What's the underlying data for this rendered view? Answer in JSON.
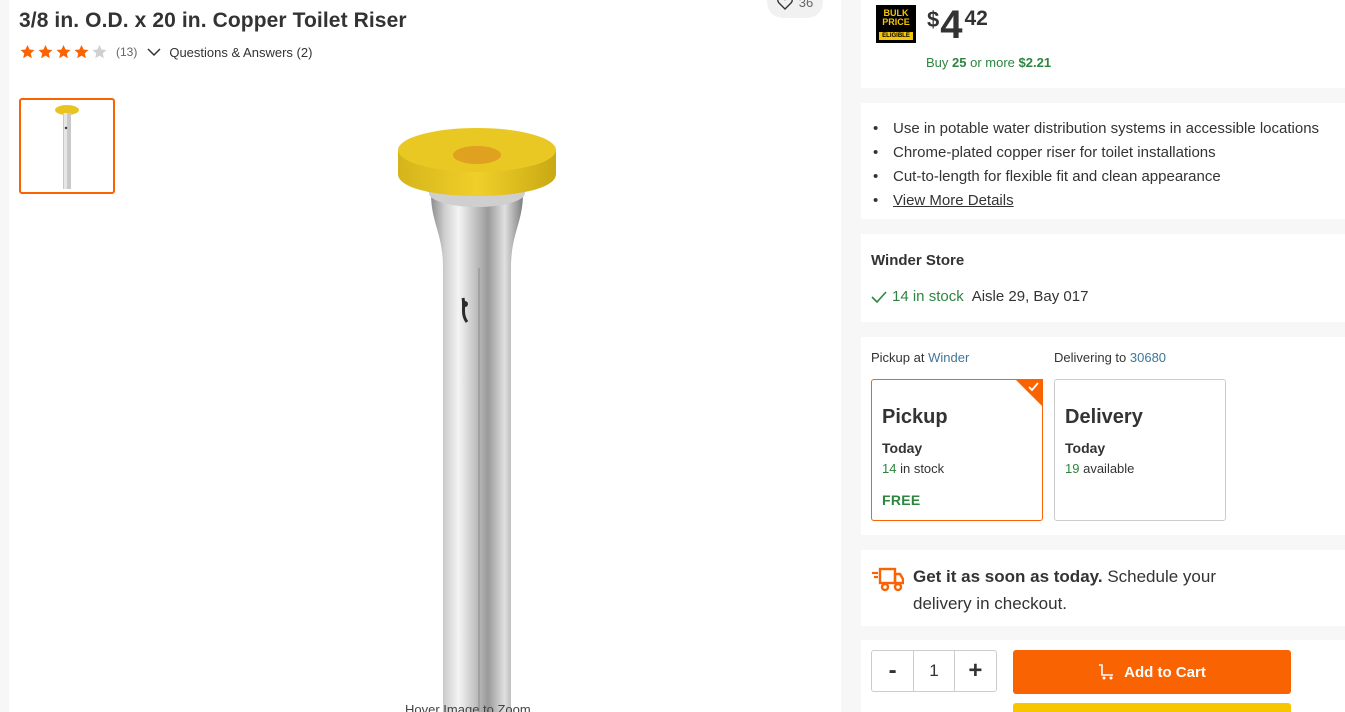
{
  "product": {
    "title": "3/8 in. O.D. x 20 in. Copper Toilet Riser",
    "favorite_count": "36",
    "rating_value": 4,
    "review_count": "(13)",
    "qa_label": "Questions & Answers (2)",
    "hover_zoom_text": "Hover Image to Zoom"
  },
  "price": {
    "bulk_badge_line1": "BULK",
    "bulk_badge_line2": "PRICE",
    "bulk_badge_line3": "ELIGIBLE",
    "currency": "$",
    "dollars": "4",
    "cents": "42",
    "bulk_prefix": "Buy",
    "bulk_qty": "25",
    "bulk_mid": "or more",
    "bulk_price": "$2.21"
  },
  "highlights": {
    "items": [
      "Use in potable water distribution systems in accessible locations",
      "Chrome-plated copper riser for toilet installations",
      "Cut-to-length for flexible fit and clean appearance"
    ],
    "view_more": "View More Details"
  },
  "store": {
    "name": "Winder Store",
    "stock": "14 in stock",
    "location": "Aisle 29, Bay 017"
  },
  "fulfillment": {
    "pickup_label": "Pickup at",
    "pickup_store": "Winder",
    "delivering_label": "Delivering to",
    "zip": "30680",
    "pickup": {
      "title": "Pickup",
      "day": "Today",
      "stock_num": "14",
      "stock_text": "in stock",
      "fee": "FREE"
    },
    "delivery": {
      "title": "Delivery",
      "day": "Today",
      "stock_num": "19",
      "stock_text": "available"
    }
  },
  "delivery_promo": {
    "bold": "Get it as soon as today.",
    "rest": "Schedule your delivery in checkout."
  },
  "cart": {
    "minus": "-",
    "quantity": "1",
    "plus": "+",
    "add_to_cart": "Add to Cart"
  },
  "colors": {
    "brand_orange": "#f96302",
    "stock_green": "#2e8540",
    "link_blue": "#3e7697",
    "star_orange": "#f96302"
  }
}
